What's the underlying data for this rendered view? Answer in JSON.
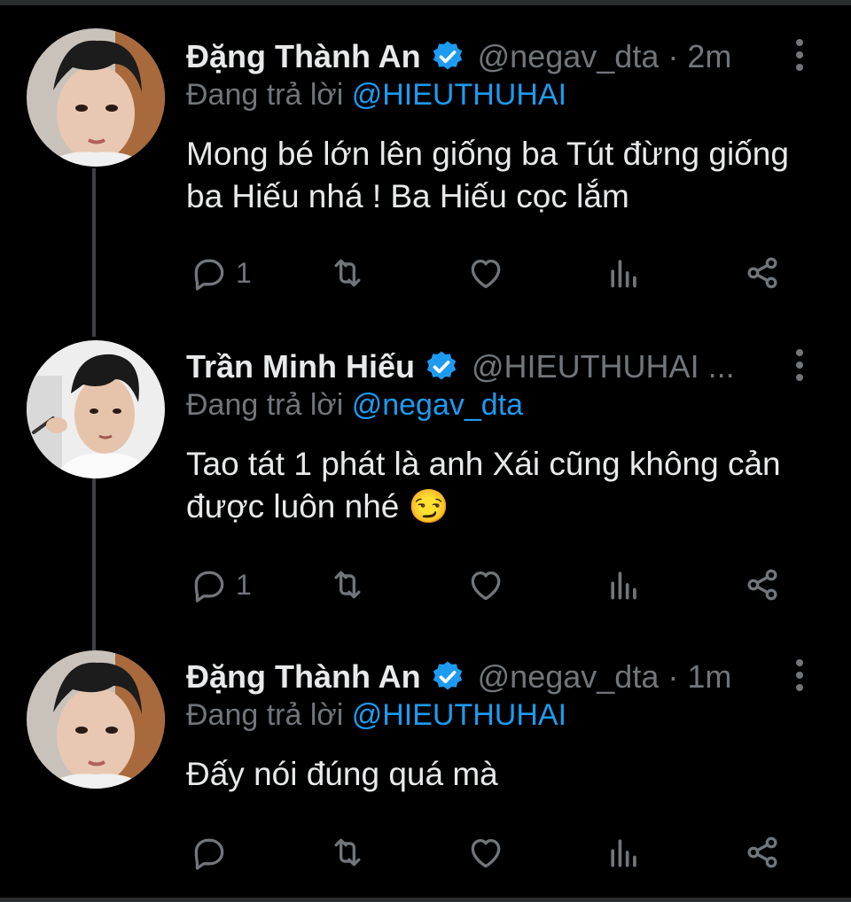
{
  "colors": {
    "background": "#000000",
    "text": "#e7e9ea",
    "muted": "#71767b",
    "accent": "#1d9bf0"
  },
  "replying_prefix": "Đang trả lời",
  "tweets": [
    {
      "name": "Đặng Thành An",
      "handle": "@negav_dta",
      "dot": "·",
      "time": "2m",
      "replying_to": "@HIEUTHUHAI",
      "text": "Mong bé lớn lên giống ba Tút đừng giống ba Hiếu nhá ! Ba Hiếu cọc lắm",
      "reply_count": "1",
      "avatar_icon": "avatar-dang-thanh-an"
    },
    {
      "name": "Trần Minh Hiếu",
      "handle": "@HIEUTHUHAI ...",
      "dot": "",
      "time": "",
      "replying_to": "@negav_dta",
      "text": "Tao tát 1 phát là anh Xái cũng không cản được luôn nhé 😏",
      "reply_count": "1",
      "avatar_icon": "avatar-tran-minh-hieu"
    },
    {
      "name": "Đặng Thành An",
      "handle": "@negav_dta",
      "dot": "·",
      "time": "1m",
      "replying_to": "@HIEUTHUHAI",
      "text": "Đấy nói đúng quá mà",
      "reply_count": "",
      "avatar_icon": "avatar-dang-thanh-an"
    }
  ],
  "action_icons": [
    "reply-icon",
    "retweet-icon",
    "like-icon",
    "views-icon",
    "share-icon"
  ]
}
